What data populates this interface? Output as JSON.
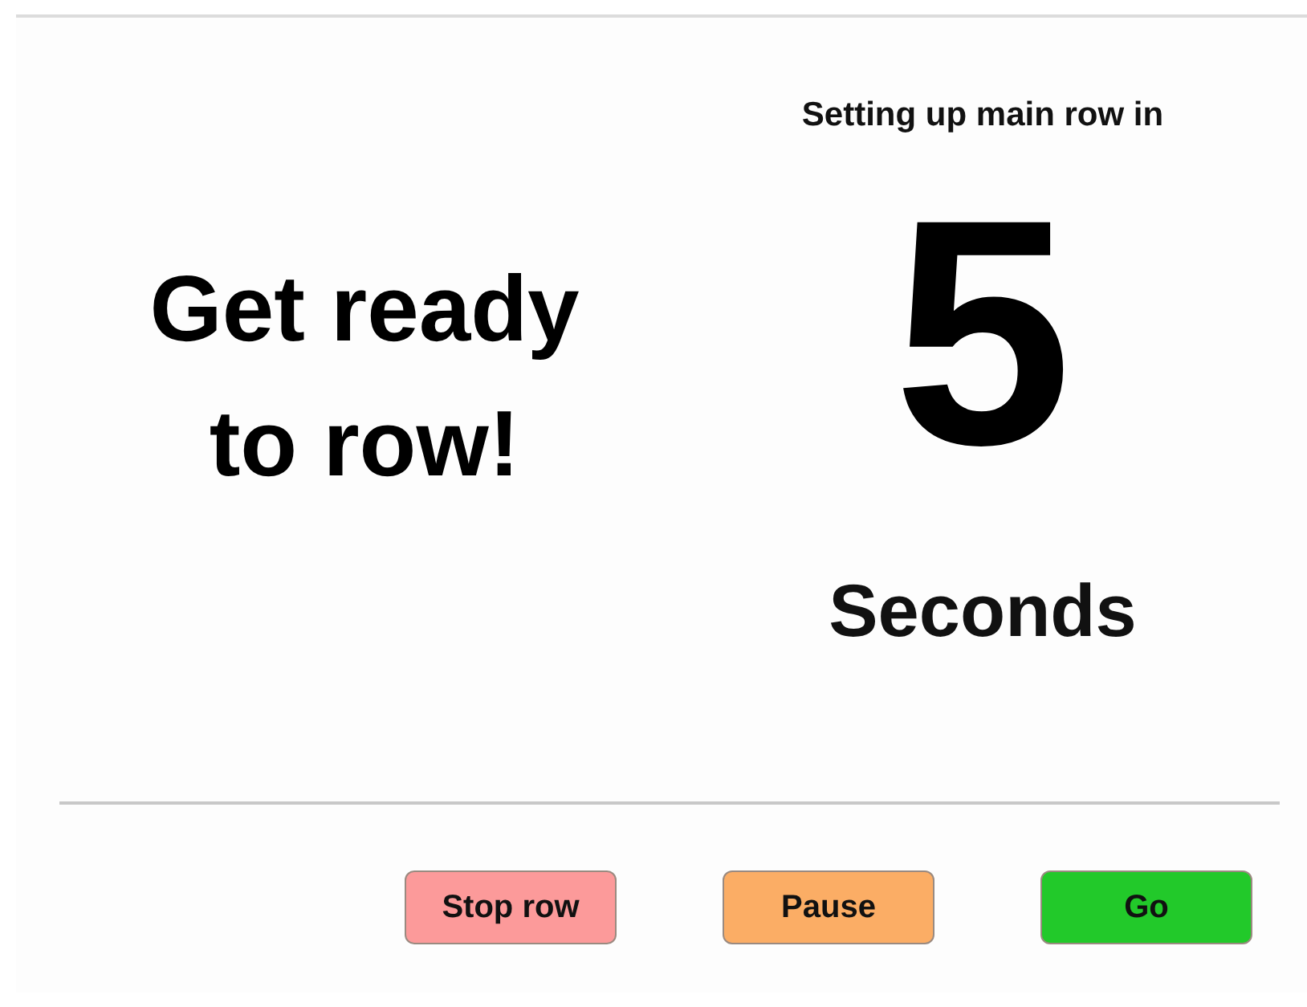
{
  "heading": "Get ready to row!",
  "countdown": {
    "caption": "Setting up main row in",
    "number": "5",
    "unit": "Seconds"
  },
  "buttons": [
    {
      "label": "Stop row",
      "color": "#fc9a9a"
    },
    {
      "label": "Pause",
      "color": "#fbad65"
    },
    {
      "label": "Go",
      "color": "#22c92a"
    }
  ]
}
